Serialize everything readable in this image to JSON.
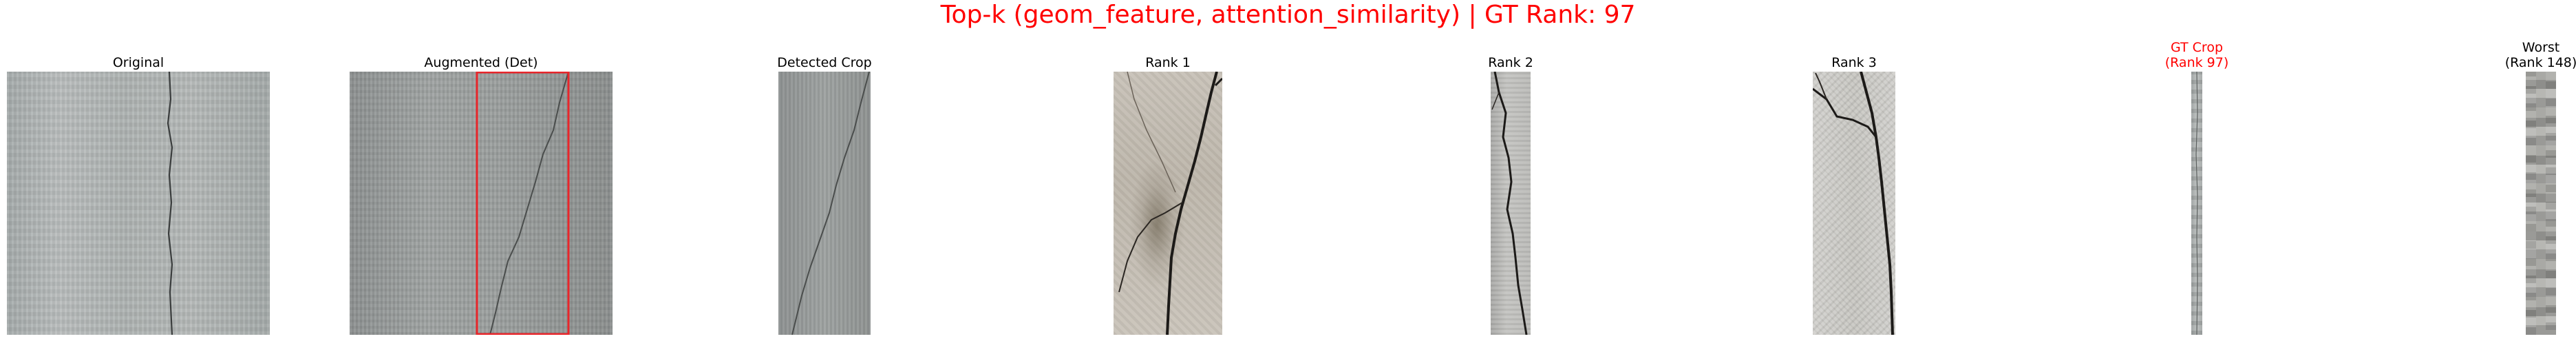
{
  "figure": {
    "title": "Top-k (geom_feature, attention_similarity) | GT Rank: 97",
    "title_color": "#ff0000",
    "bbox_color": "#e8262b",
    "crack_color": "#1c1a18"
  },
  "panels": [
    {
      "id": "original",
      "title": "Original"
    },
    {
      "id": "augmented",
      "title": "Augmented (Det)"
    },
    {
      "id": "detected",
      "title": "Detected Crop"
    },
    {
      "id": "rank1",
      "title": "Rank 1"
    },
    {
      "id": "rank2",
      "title": "Rank 2"
    },
    {
      "id": "rank3",
      "title": "Rank 3"
    },
    {
      "id": "gt",
      "title": "GT Crop\n(Rank 97)",
      "highlight": true
    },
    {
      "id": "worst",
      "title": "Worst\n(Rank 148)"
    }
  ]
}
